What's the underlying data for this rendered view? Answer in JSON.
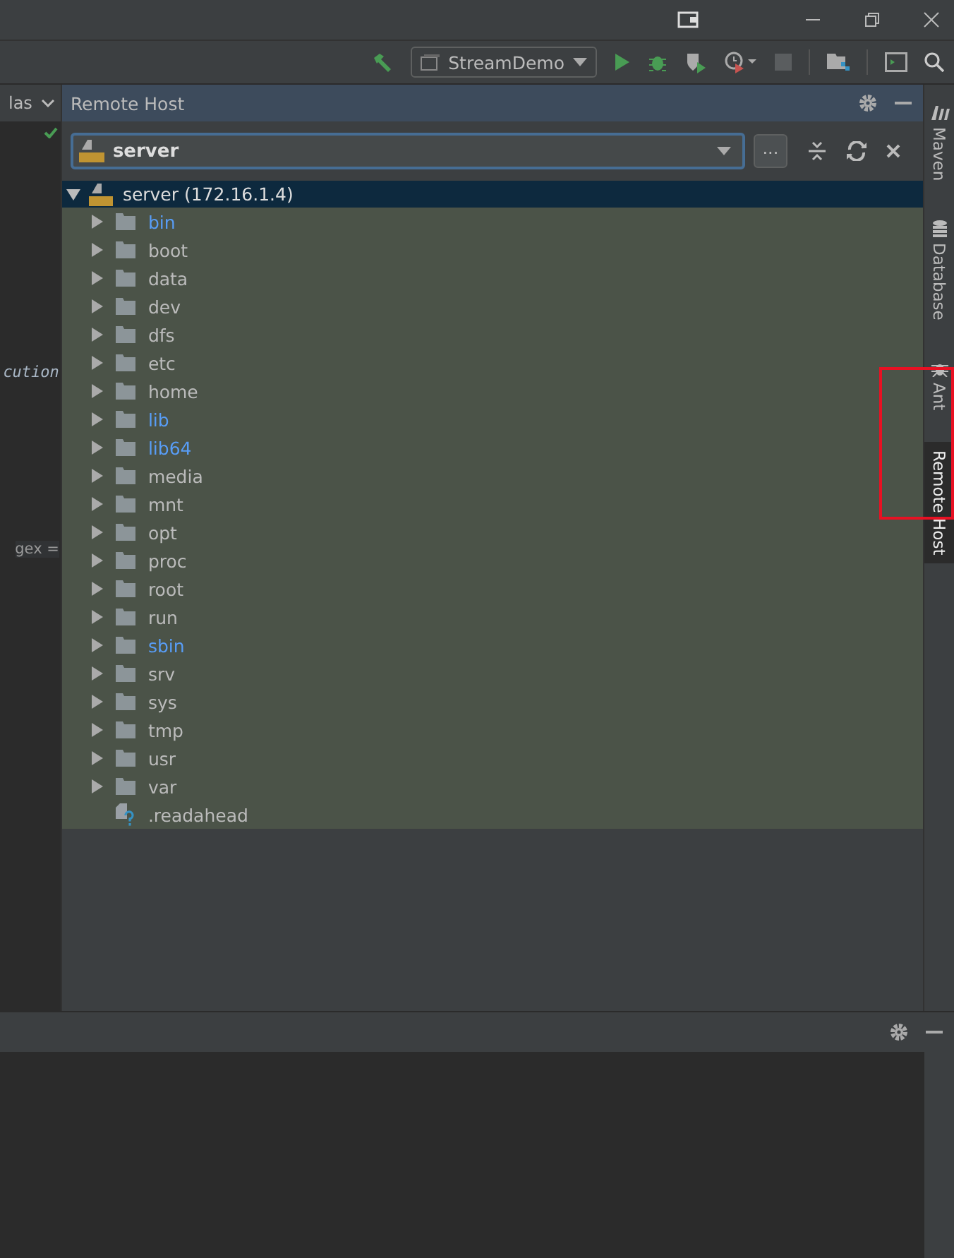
{
  "toolbar": {
    "run_config": "StreamDemo"
  },
  "editor": {
    "tab_label": "las",
    "fragments": [
      {
        "text": "cution",
        "kind": "italic"
      },
      {
        "text": "gex =",
        "kind": "plain"
      }
    ]
  },
  "remote_host": {
    "title": "Remote Host",
    "server": "server",
    "more_button": "...",
    "tree": {
      "label": "server (172.16.1.4)",
      "expanded": true,
      "selected": true,
      "children": [
        {
          "name": "bin",
          "kind": "folder",
          "symlink": true
        },
        {
          "name": "boot",
          "kind": "folder",
          "symlink": false
        },
        {
          "name": "data",
          "kind": "folder",
          "symlink": false
        },
        {
          "name": "dev",
          "kind": "folder",
          "symlink": false
        },
        {
          "name": "dfs",
          "kind": "folder",
          "symlink": false
        },
        {
          "name": "etc",
          "kind": "folder",
          "symlink": false
        },
        {
          "name": "home",
          "kind": "folder",
          "symlink": false
        },
        {
          "name": "lib",
          "kind": "folder",
          "symlink": true
        },
        {
          "name": "lib64",
          "kind": "folder",
          "symlink": true
        },
        {
          "name": "media",
          "kind": "folder",
          "symlink": false
        },
        {
          "name": "mnt",
          "kind": "folder",
          "symlink": false
        },
        {
          "name": "opt",
          "kind": "folder",
          "symlink": false
        },
        {
          "name": "proc",
          "kind": "folder",
          "symlink": false
        },
        {
          "name": "root",
          "kind": "folder",
          "symlink": false
        },
        {
          "name": "run",
          "kind": "folder",
          "symlink": false
        },
        {
          "name": "sbin",
          "kind": "folder",
          "symlink": true
        },
        {
          "name": "srv",
          "kind": "folder",
          "symlink": false
        },
        {
          "name": "sys",
          "kind": "folder",
          "symlink": false
        },
        {
          "name": "tmp",
          "kind": "folder",
          "symlink": false
        },
        {
          "name": "usr",
          "kind": "folder",
          "symlink": false
        },
        {
          "name": "var",
          "kind": "folder",
          "symlink": false
        },
        {
          "name": ".readahead",
          "kind": "file",
          "symlink": false
        }
      ]
    }
  },
  "side_tabs": [
    {
      "label": "Maven",
      "kind": "maven",
      "selected": false
    },
    {
      "label": "Database",
      "kind": "database",
      "selected": false
    },
    {
      "label": "Ant",
      "kind": "ant",
      "selected": false
    },
    {
      "label": "Remote Host",
      "kind": "plain",
      "selected": true,
      "highlighted": true
    }
  ]
}
